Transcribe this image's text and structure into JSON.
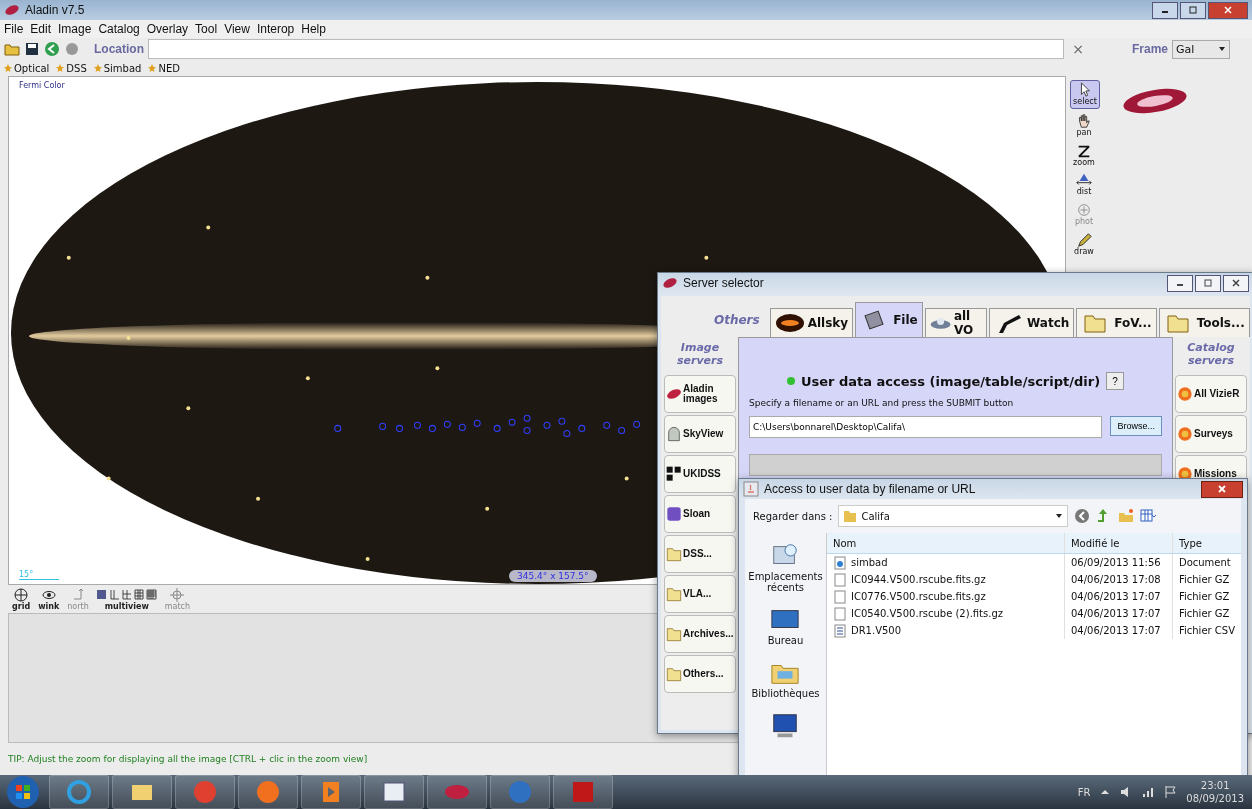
{
  "main_window": {
    "title": "Aladin v7.5",
    "menu": [
      "File",
      "Edit",
      "Image",
      "Catalog",
      "Overlay",
      "Tool",
      "View",
      "Interop",
      "Help"
    ],
    "location_label": "Location",
    "clear": "×",
    "frame_label": "Frame",
    "frame_value": "Gal",
    "bookmarks": [
      "Optical",
      "DSS",
      "Simbad",
      "NED"
    ],
    "view": {
      "label": "Fermi Color",
      "scale": "15°",
      "field_size": "345.4° x 157.5°"
    },
    "tools": [
      {
        "kind": "select",
        "label": "select",
        "selected": true,
        "disabled": false
      },
      {
        "kind": "pan",
        "label": "pan",
        "selected": false,
        "disabled": false
      },
      {
        "kind": "zoom",
        "label": "zoom",
        "selected": false,
        "disabled": false
      },
      {
        "kind": "dist",
        "label": "dist",
        "selected": false,
        "disabled": false
      },
      {
        "kind": "phot",
        "label": "phot",
        "selected": false,
        "disabled": true
      },
      {
        "kind": "draw",
        "label": "draw",
        "selected": false,
        "disabled": false
      }
    ],
    "view_buttons": [
      {
        "kind": "grid",
        "label": "grid",
        "disabled": false
      },
      {
        "kind": "wink",
        "label": "wink",
        "disabled": false
      },
      {
        "kind": "north",
        "label": "north",
        "disabled": true
      },
      {
        "kind": "multiview",
        "label": "multiview",
        "disabled": false
      },
      {
        "kind": "match",
        "label": "match",
        "disabled": true
      }
    ],
    "tip": "TIP: Adjust the zoom for displaying all the image [CTRL + clic in the zoom view]"
  },
  "server_selector": {
    "title": "Server selector",
    "others_label": "Others",
    "tabs": [
      {
        "kind": "allsky",
        "label": "Allsky",
        "selected": false
      },
      {
        "kind": "file",
        "label": "File",
        "selected": true
      },
      {
        "kind": "vo",
        "label": "all VO",
        "selected": false
      },
      {
        "kind": "watch",
        "label": "Watch",
        "selected": false
      },
      {
        "kind": "folder",
        "label": "FoV...",
        "selected": false
      },
      {
        "kind": "folder",
        "label": "Tools...",
        "selected": false
      }
    ],
    "image_servers_label": "Image servers",
    "catalog_servers_label": "Catalog servers",
    "image_servers": [
      {
        "kind": "aladin",
        "label": "Aladin images"
      },
      {
        "kind": "skyview",
        "label": "SkyView"
      },
      {
        "kind": "ukidss",
        "label": "UKIDSS"
      },
      {
        "kind": "sloan",
        "label": "Sloan"
      },
      {
        "kind": "folder",
        "label": "DSS..."
      },
      {
        "kind": "folder",
        "label": "VLA..."
      },
      {
        "kind": "folder",
        "label": "Archives..."
      },
      {
        "kind": "folder",
        "label": "Others..."
      }
    ],
    "catalog_servers": [
      "All VizieR",
      "Surveys",
      "Missions"
    ],
    "heading": "User data access (image/table/script/dir)",
    "help": "?",
    "instruction": "Specify a filename or an URL and press the SUBMIT button",
    "path_value": "C:\\Users\\bonnarel\\Desktop\\Califa\\",
    "browse": "Browse..."
  },
  "file_dialog": {
    "title": "Access to user data by filename or URL",
    "look_in_label": "Regarder dans :",
    "folder": "Califa",
    "places": [
      {
        "kind": "recent",
        "label": "Emplacements récents"
      },
      {
        "kind": "desktop",
        "label": "Bureau"
      },
      {
        "kind": "libraries",
        "label": "Bibliothèques"
      },
      {
        "kind": "computer"
      }
    ],
    "columns": [
      "Nom",
      "Modifié le",
      "Type"
    ],
    "files": [
      {
        "kind": "document",
        "name": "simbad",
        "modified": "06/09/2013 11:56",
        "type": "Document"
      },
      {
        "kind": "file",
        "name": "IC0944.V500.rscube.fits.gz",
        "modified": "04/06/2013 17:08",
        "type": "Fichier GZ"
      },
      {
        "kind": "file",
        "name": "IC0776.V500.rscube.fits.gz",
        "modified": "04/06/2013 17:07",
        "type": "Fichier GZ"
      },
      {
        "kind": "file",
        "name": "IC0540.V500.rscube (2).fits.gz",
        "modified": "04/06/2013 17:07",
        "type": "Fichier GZ"
      },
      {
        "kind": "csv",
        "name": "DR1.V500",
        "modified": "04/06/2013 17:07",
        "type": "Fichier CSV"
      }
    ]
  },
  "taskbar": {
    "language": "FR",
    "time": "23:01",
    "date": "08/09/2013"
  }
}
